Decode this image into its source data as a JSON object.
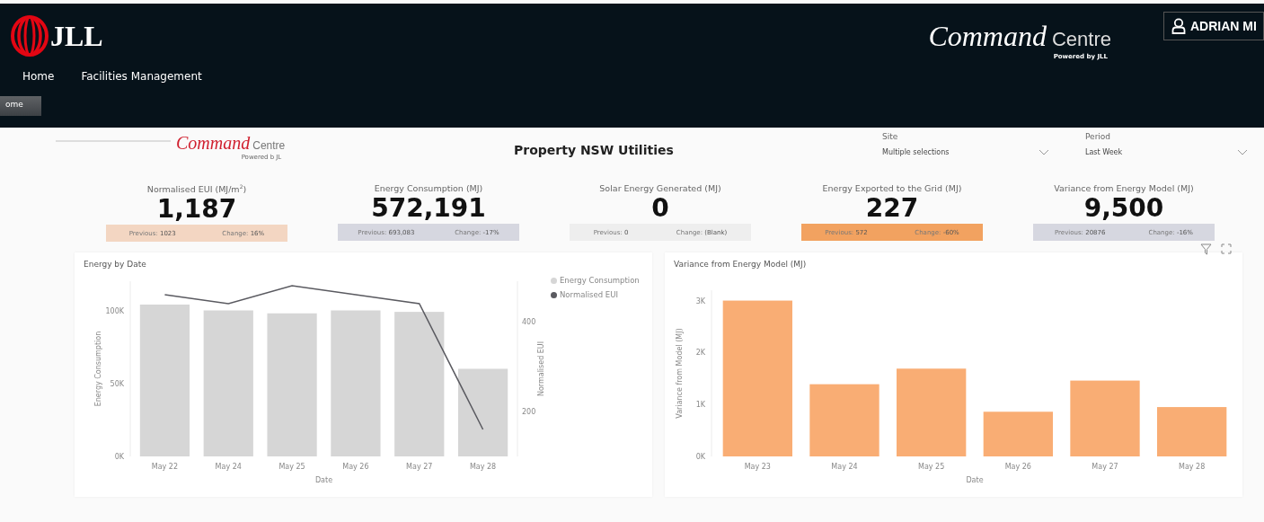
{
  "header": {
    "brand": "JLL",
    "nav": [
      {
        "label": "Home"
      },
      {
        "label": "Facilities Management"
      }
    ],
    "page_tab": {
      "label": "ome",
      "selected": true
    },
    "product_logo": {
      "script": "Command",
      "word": "Centre",
      "tagline": "Powered by JLL"
    },
    "user_button": {
      "label": "ADRIAN MI"
    }
  },
  "report": {
    "logo": {
      "script": "Command",
      "word": "Centre",
      "tagline": "Powered b JL"
    },
    "title": "Property NSW Utilities",
    "slicers": [
      {
        "label": "Site",
        "value": "Multiple selections"
      },
      {
        "label": "Period",
        "value": "Last Week"
      }
    ]
  },
  "kpis": [
    {
      "title": "Normalised EUI (MJ/m$^{2}$)",
      "value": "1,187",
      "previous_label": "Previous:",
      "previous": "1023",
      "change_label": "Change:",
      "change": "16%",
      "color": "#f3d6c2"
    },
    {
      "title": "Energy Consumption (MJ)",
      "value": "572,191",
      "previous_label": "Previous:",
      "previous": "693,083",
      "change_label": "Change:",
      "change": "-17%",
      "color": "#d6d7e0"
    },
    {
      "title": "Solar Energy Generated (MJ)",
      "value": "0",
      "previous_label": "Previous:",
      "previous": "0",
      "change_label": "Change:",
      "change": "(Blank)",
      "color": "#eeeeee"
    },
    {
      "title": "Energy Exported to the Grid (MJ)",
      "value": "227",
      "previous_label": "Previous:",
      "previous": "572",
      "change_label": "Change:",
      "change": "-60%",
      "color": "#f2a260"
    },
    {
      "title": "Variance from Energy Model (MJ)",
      "value": "9,500",
      "previous_label": "Previous:",
      "previous": "20876",
      "change_label": "Change:",
      "change": "-16%",
      "color": "#d6d7e0"
    }
  ],
  "charts": [
    {
      "title": "Energy by Date",
      "chart_data": {
        "type": "bar",
        "xlabel": "Date",
        "ylabel": "Energy Consumption",
        "y2label": "Normalised EUI",
        "categories": [
          "May 22",
          "May 24",
          "May 25",
          "May 26",
          "May 27",
          "May 28"
        ],
        "series": [
          {
            "name": "Energy Consumption",
            "color": "#d6d6d6",
            "type": "bar",
            "values": [
              104000,
              100000,
              98000,
              100000,
              99000,
              60000
            ]
          },
          {
            "name": "Normalised EUI",
            "color": "#5a5a60",
            "type": "line",
            "axis": "y2",
            "values": [
              460,
              440,
              480,
              460,
              440,
              160
            ]
          }
        ],
        "legend": "right",
        "ylim": [
          0,
          120000
        ],
        "y2lim": [
          100,
          490
        ],
        "yticks": [
          {
            "value": 0,
            "label": "0K"
          },
          {
            "value": 50000,
            "label": "50K"
          },
          {
            "value": 100000,
            "label": "100K"
          }
        ],
        "y2ticks": [
          200,
          400
        ]
      }
    },
    {
      "title": "Variance from Energy Model (MJ)",
      "chart_data": {
        "type": "bar",
        "xlabel": "Date",
        "ylabel": "Variance from Model (MJ)",
        "categories": [
          "May 23",
          "May 24",
          "May 25",
          "May 26",
          "May 27",
          "May 28"
        ],
        "series": [
          {
            "color": "#f9ad74",
            "values": [
              3000,
              1390,
              1690,
              860,
              1460,
              950
            ]
          }
        ],
        "ylim": [
          0,
          3200
        ],
        "yticks": [
          {
            "value": 0,
            "label": "0K"
          },
          {
            "value": 1000,
            "label": "1K"
          },
          {
            "value": 2000,
            "label": "2K"
          },
          {
            "value": 3000,
            "label": "3K"
          }
        ]
      }
    }
  ]
}
